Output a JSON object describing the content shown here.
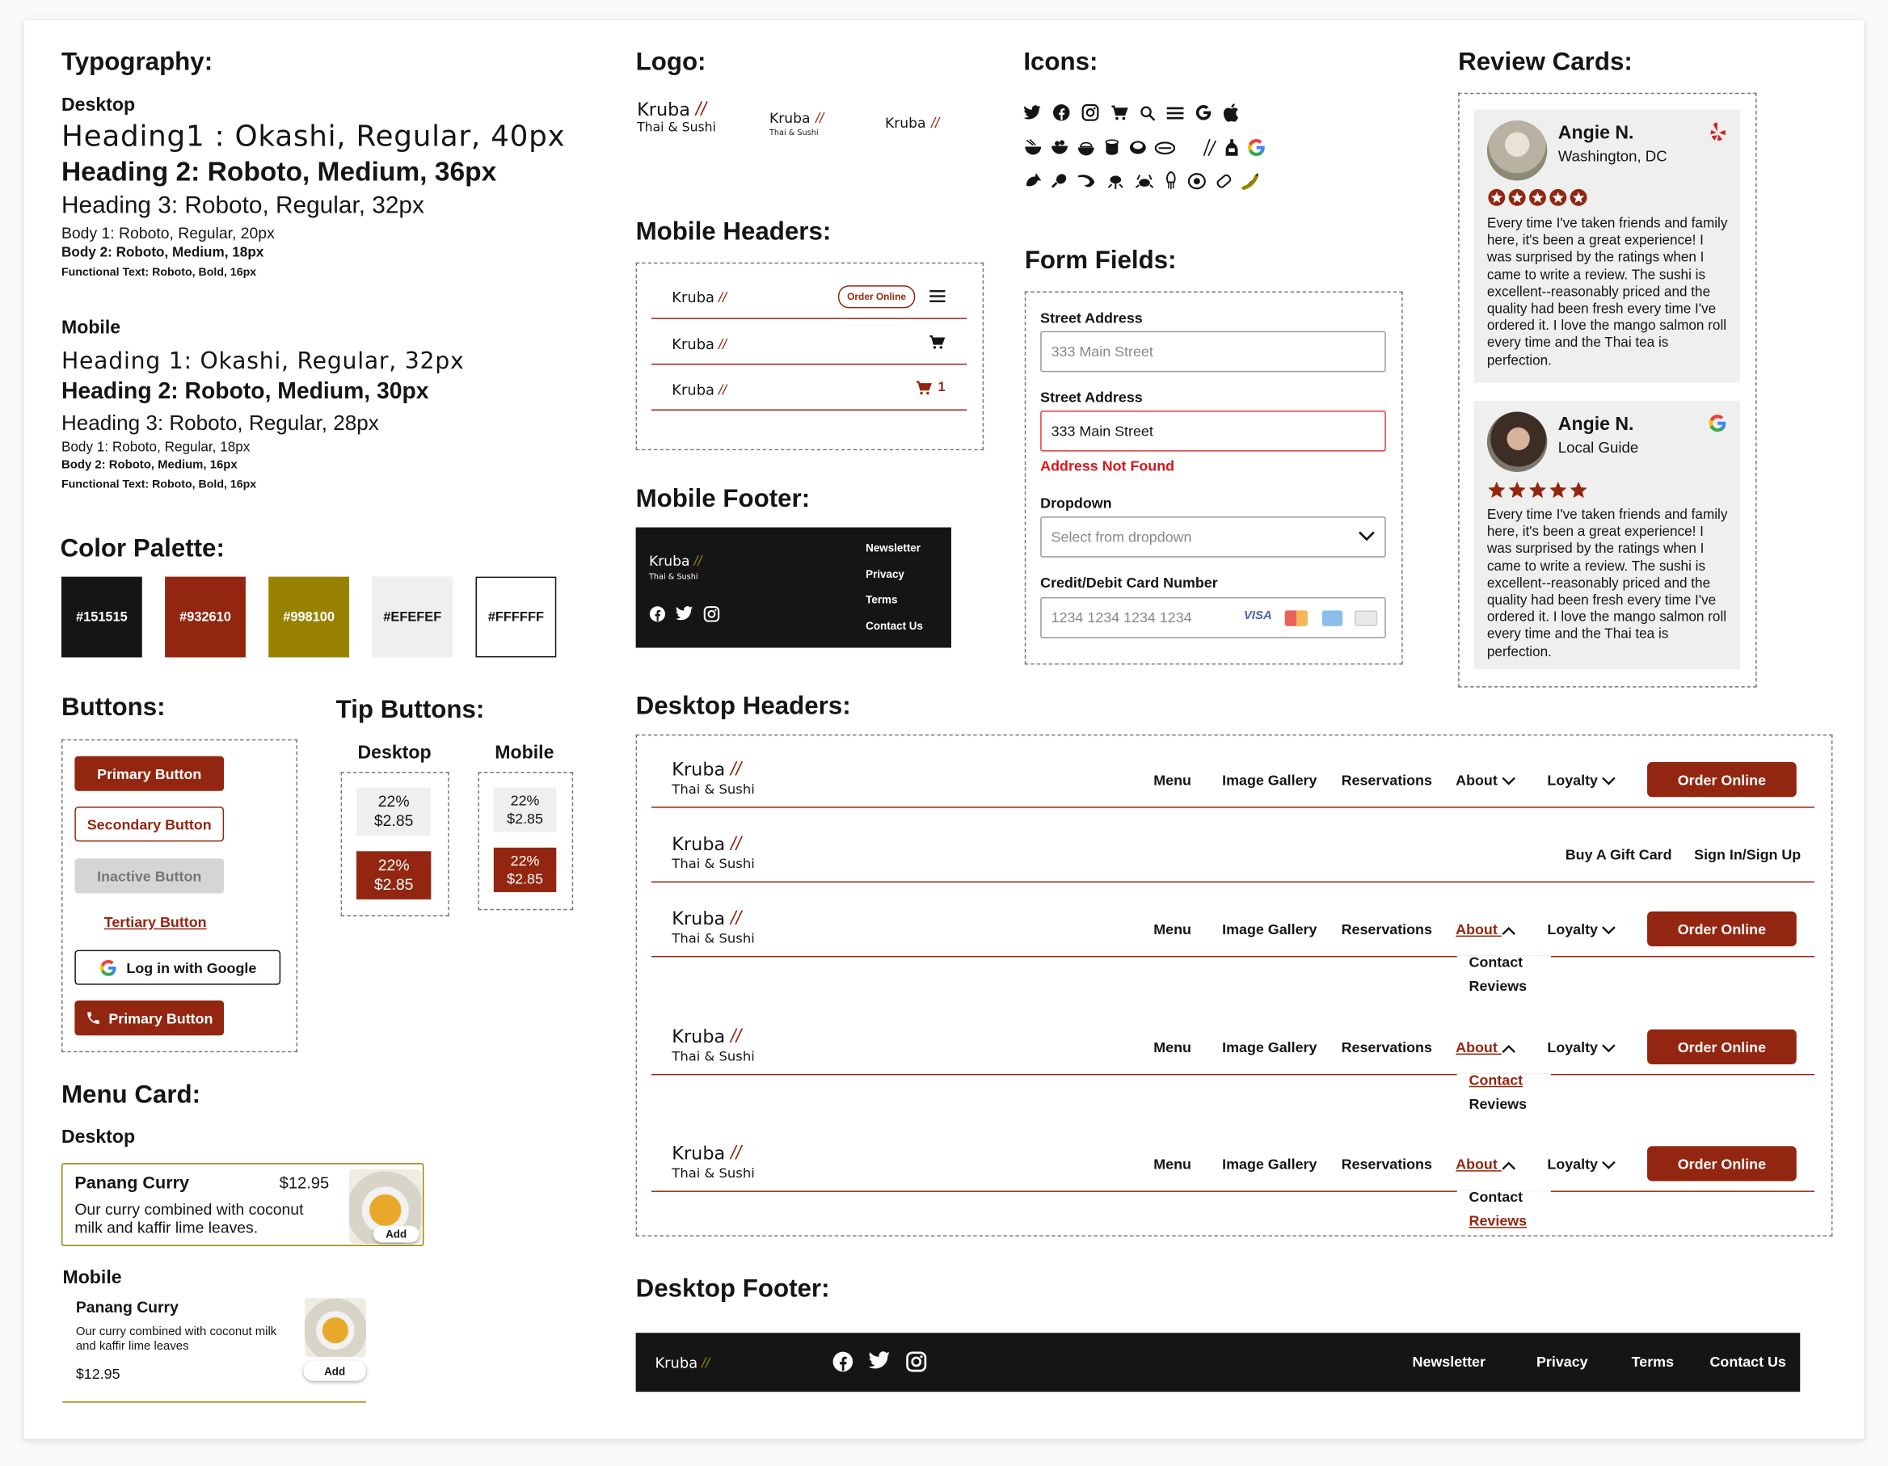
{
  "colors": {
    "black": "#151515",
    "red": "#932610",
    "gold": "#998100",
    "grey": "#EFEFEF",
    "white": "#FFFFFF"
  },
  "typography": {
    "title": "Typography:",
    "desktop_label": "Desktop",
    "d_h1": "Heading1 : Okashi, Regular, 40px",
    "d_h2": "Heading 2: Roboto, Medium, 36px",
    "d_h3": "Heading 3: Roboto, Regular, 32px",
    "d_b1": "Body 1: Roboto, Regular, 20px",
    "d_b2": "Body 2: Roboto, Medium, 18px",
    "d_fn": "Functional Text: Roboto, Bold, 16px",
    "mobile_label": "Mobile",
    "m_h1": "Heading 1: Okashi, Regular, 32px",
    "m_h2": "Heading 2: Roboto, Medium, 30px",
    "m_h3": "Heading 3: Roboto, Regular, 28px",
    "m_b1": "Body 1: Roboto, Regular, 18px",
    "m_b2": "Body 2: Roboto, Medium, 16px",
    "m_fn": "Functional Text: Roboto, Bold, 16px"
  },
  "palette": {
    "title": "Color Palette:",
    "swatches": [
      "#151515",
      "#932610",
      "#998100",
      "#EFEFEF",
      "#FFFFFF"
    ]
  },
  "buttons": {
    "title": "Buttons:",
    "primary": "Primary Button",
    "secondary": "Secondary Button",
    "inactive": "Inactive Button",
    "tertiary": "Tertiary Button",
    "google": "Log in with Google",
    "primary_icon": "Primary Button"
  },
  "tips": {
    "title": "Tip Buttons:",
    "desktop": "Desktop",
    "mobile": "Mobile",
    "pct": "22%",
    "amt": "$2.85"
  },
  "menu_card": {
    "title": "Menu Card:",
    "desktop": "Desktop",
    "mobile": "Mobile",
    "name": "Panang Curry",
    "price": "$12.95",
    "desc_d": "Our curry combined with coconut milk and kaffir lime leaves.",
    "desc_m": "Our curry combined with coconut milk and kaffir lime leaves",
    "add": "Add"
  },
  "logo": {
    "title": "Logo:",
    "name": "Kruba",
    "tagline": "Thai & Sushi"
  },
  "mobile_headers": {
    "title": "Mobile Headers:",
    "order": "Order Online",
    "cart_count": "1"
  },
  "mobile_footer": {
    "title": "Mobile Footer:",
    "links": [
      "Newsletter",
      "Privacy",
      "Terms",
      "Contact Us"
    ]
  },
  "icons": {
    "title": "Icons:",
    "row1": [
      "twitter-icon",
      "facebook-icon",
      "instagram-icon",
      "cart-icon",
      "search-icon",
      "menu-icon",
      "google-icon",
      "apple-icon"
    ],
    "row2": [
      "ramen-icon",
      "bowl-icon",
      "rice-bowl-icon",
      "cup-icon",
      "sushi-roll-icon",
      "nigiri-icon",
      "chopsticks-icon",
      "sake-icon",
      "google-color-icon"
    ],
    "row3": [
      "fish-icon",
      "drumstick-icon",
      "shrimp-icon",
      "lobster-icon",
      "crab-icon",
      "squid-icon",
      "sushi-icon",
      "egg-icon",
      "pepper-icon"
    ]
  },
  "form": {
    "title": "Form Fields:",
    "street_label": "Street Address",
    "street_placeholder": "333 Main Street",
    "street_value": "333 Main Street",
    "error": "Address Not Found",
    "dropdown_label": "Dropdown",
    "dropdown_placeholder": "Select from dropdown",
    "card_label": "Credit/Debit Card Number",
    "card_placeholder": "1234 1234 1234 1234",
    "visa": "VISA"
  },
  "reviews": {
    "title": "Review Cards:",
    "name": "Angie N.",
    "loc1": "Washington, DC",
    "loc2": "Local Guide",
    "text": "Every time I've taken friends and family here, it's been a great experience! I was surprised by the ratings when I came to write a review. The sushi is excellent--reasonably priced and the quality had been fresh every time I've ordered it. I love the mango salmon roll every time and the Thai tea is perfection.",
    "rating": 5
  },
  "desktop_headers": {
    "title": "Desktop Headers:",
    "menu": "Menu",
    "gallery": "Image Gallery",
    "reservations": "Reservations",
    "about": "About",
    "loyalty": "Loyalty",
    "order": "Order Online",
    "gift": "Buy A Gift Card",
    "signin": "Sign In/Sign Up",
    "contact": "Contact",
    "reviews": "Reviews"
  },
  "desktop_footer": {
    "title": "Desktop Footer:",
    "links": [
      "Newsletter",
      "Privacy",
      "Terms",
      "Contact Us"
    ]
  }
}
